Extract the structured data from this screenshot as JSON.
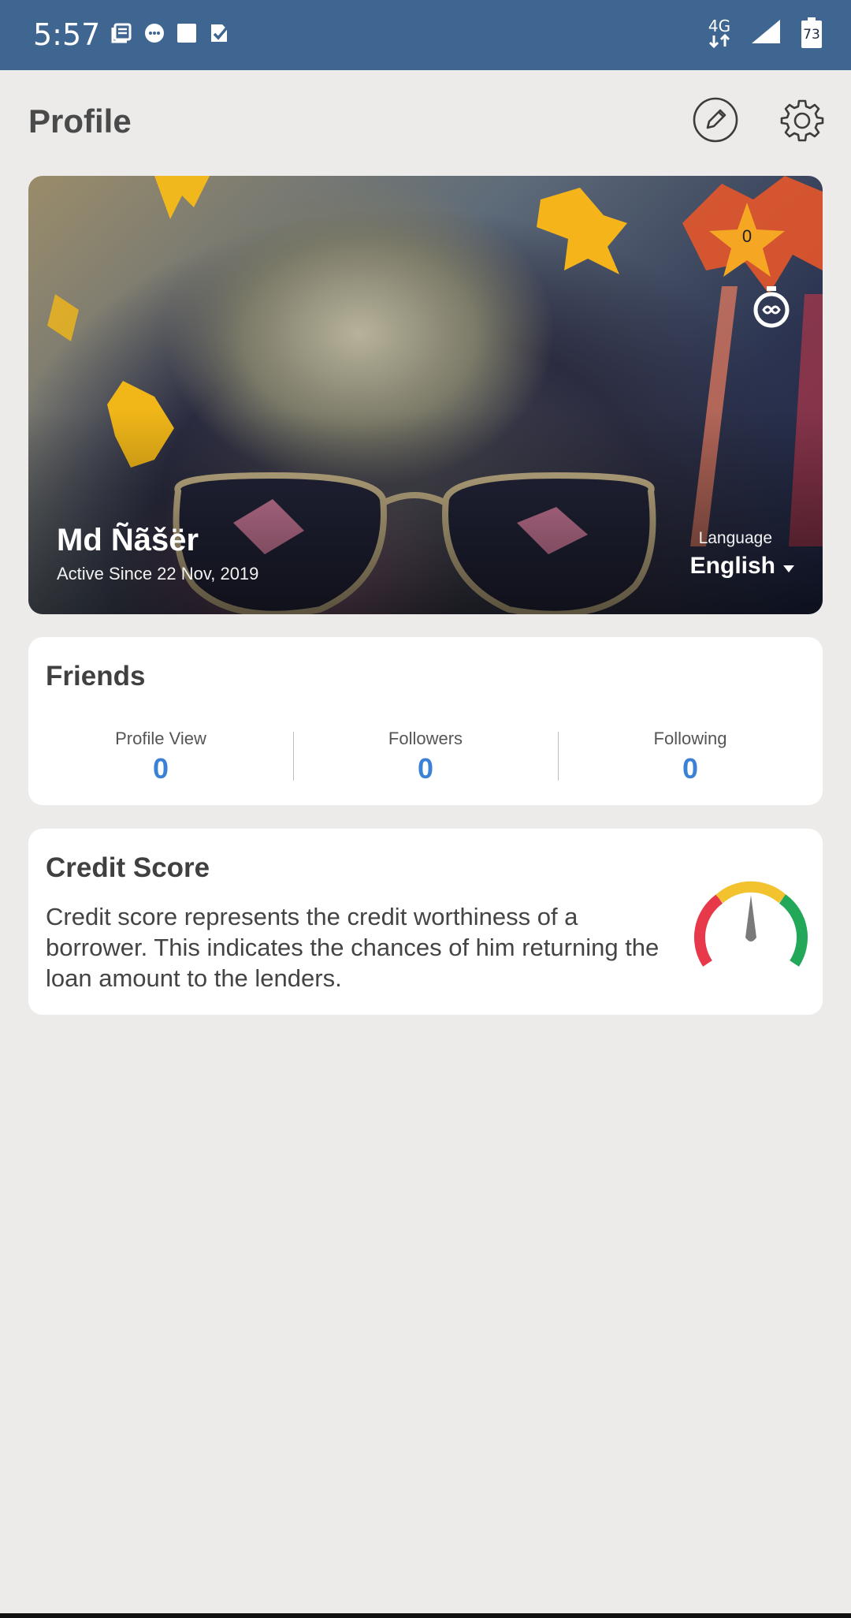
{
  "status_bar": {
    "time": "5:57",
    "network": "4G",
    "battery": "73",
    "notification_icons": [
      "news-icon",
      "chat-icon",
      "square-icon",
      "check-icon"
    ]
  },
  "header": {
    "title": "Profile",
    "edit_icon": "pencil-icon",
    "settings_icon": "gear-icon"
  },
  "profile": {
    "name": "Md Ñãšër",
    "active_since": "Active Since 22 Nov, 2019",
    "star_count": "0",
    "language_label": "Language",
    "language_value": "English"
  },
  "friends": {
    "title": "Friends",
    "stats": [
      {
        "label": "Profile View",
        "value": "0"
      },
      {
        "label": "Followers",
        "value": "0"
      },
      {
        "label": "Following",
        "value": "0"
      }
    ]
  },
  "credit_score": {
    "title": "Credit Score",
    "description": "Credit score represents the credit worthiness of a borrower. This indicates the chances of him returning the loan amount to the lenders.",
    "gauge_colors": [
      "#e8394a",
      "#f3c22f",
      "#23a85a"
    ]
  },
  "colors": {
    "status_bar": "#3f6591",
    "accent": "#3b82d6",
    "background": "#ecebea"
  }
}
